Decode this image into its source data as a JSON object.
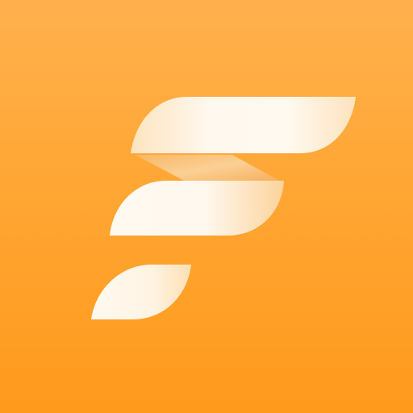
{
  "app_icon": {
    "icon": "stylized-letter-f-logo-icon",
    "colors": {
      "background_top": "#ffb14e",
      "background_bottom": "#ff9a1c",
      "glyph_light": "#fff9ee",
      "glyph_shade": "#fcd6a1",
      "fold_shadow": "#f6b15f"
    }
  }
}
